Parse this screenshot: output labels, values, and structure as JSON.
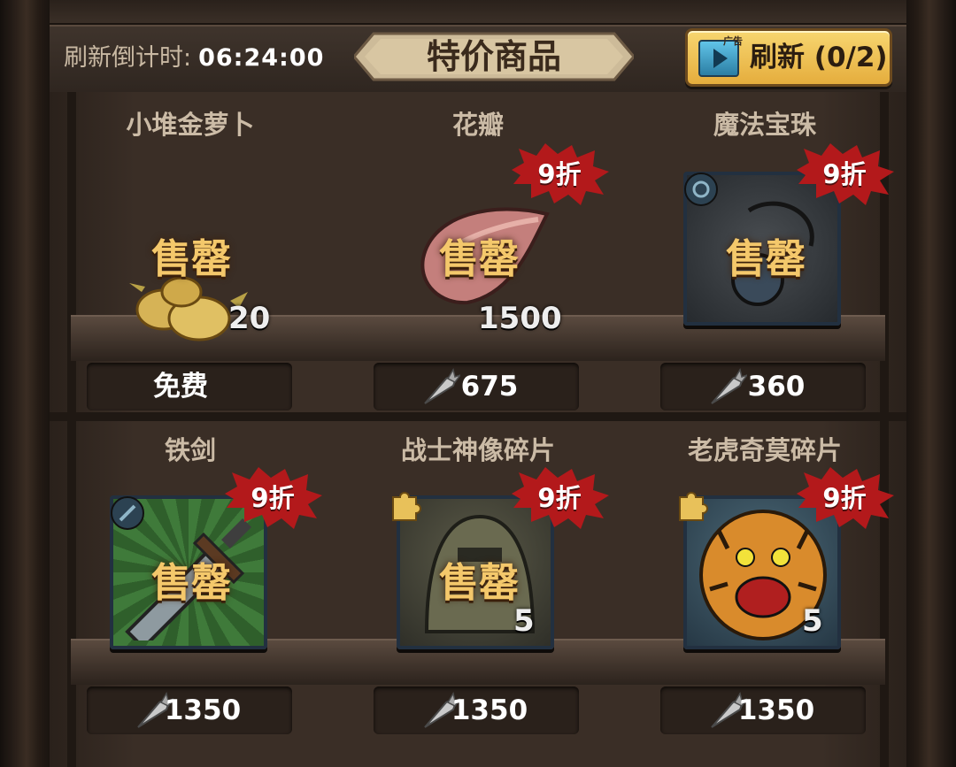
{
  "header": {
    "countdown_label": "刷新倒计时:",
    "countdown_time": "06:24:00",
    "title": "特价商品",
    "refresh_ad_tag": "广告",
    "refresh_label": "刷新 (0/2)"
  },
  "items": [
    {
      "name": "小堆金萝卜",
      "status": "售罄",
      "quantity": "20",
      "price": "免费",
      "discount": ""
    },
    {
      "name": "花瓣",
      "status": "售罄",
      "quantity": "1500",
      "price": "675",
      "discount": "9折"
    },
    {
      "name": "魔法宝珠",
      "status": "售罄",
      "quantity": "",
      "price": "360",
      "discount": "9折"
    },
    {
      "name": "铁剑",
      "status": "售罄",
      "quantity": "",
      "price": "1350",
      "discount": "9折"
    },
    {
      "name": "战士神像碎片",
      "status": "售罄",
      "quantity": "5",
      "price": "1350",
      "discount": "9折"
    },
    {
      "name": "老虎奇莫碎片",
      "status": "",
      "quantity": "5",
      "price": "1350",
      "discount": "9折"
    }
  ],
  "colors": {
    "soldout": "#f4c86b",
    "badge": "#b3191b",
    "button": "#f0c457"
  },
  "icons": {
    "currency": "silver-carrot-icon",
    "refresh_ad": "video-ad-icon"
  }
}
